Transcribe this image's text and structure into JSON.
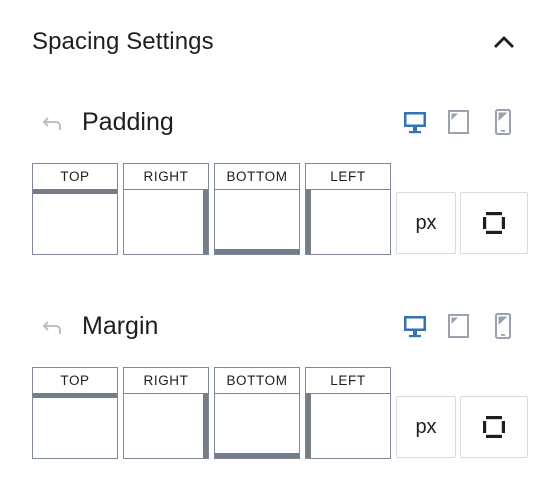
{
  "header": {
    "title": "Spacing Settings",
    "collapse_icon": "chevron-up-icon"
  },
  "padding": {
    "label": "Padding",
    "sides": {
      "top": "TOP",
      "right": "RIGHT",
      "bottom": "BOTTOM",
      "left": "LEFT"
    },
    "unit": "px",
    "active_device": "desktop"
  },
  "margin": {
    "label": "Margin",
    "sides": {
      "top": "TOP",
      "right": "RIGHT",
      "bottom": "BOTTOM",
      "left": "LEFT"
    },
    "unit": "px",
    "active_device": "desktop"
  },
  "colors": {
    "active_device": "#3273b3",
    "inactive_device": "#9aa3ad",
    "side_indicator": "#757d88",
    "field_border": "#7e8899"
  }
}
